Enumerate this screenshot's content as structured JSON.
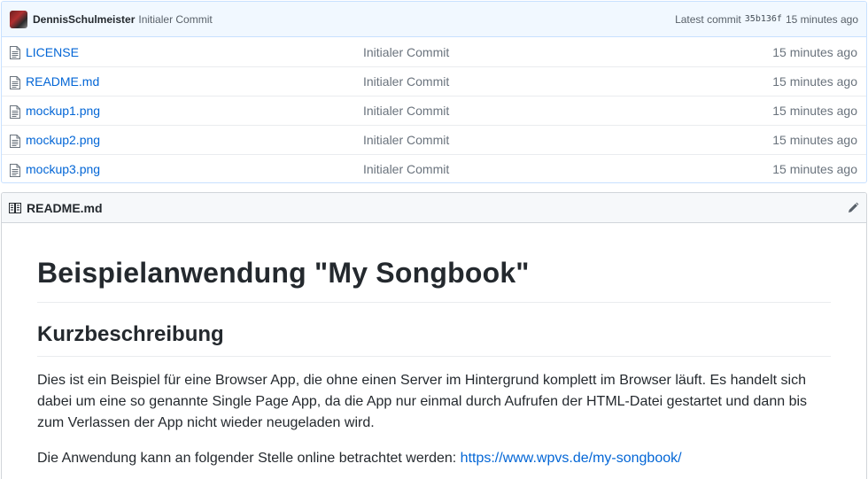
{
  "commit": {
    "author": "DennisSchulmeister",
    "message": "Initialer Commit",
    "latest_label": "Latest commit",
    "sha": "35b136f",
    "age": "15 minutes ago"
  },
  "files": [
    {
      "name": "LICENSE",
      "message": "Initialer Commit",
      "age": "15 minutes ago"
    },
    {
      "name": "README.md",
      "message": "Initialer Commit",
      "age": "15 minutes ago"
    },
    {
      "name": "mockup1.png",
      "message": "Initialer Commit",
      "age": "15 minutes ago"
    },
    {
      "name": "mockup2.png",
      "message": "Initialer Commit",
      "age": "15 minutes ago"
    },
    {
      "name": "mockup3.png",
      "message": "Initialer Commit",
      "age": "15 minutes ago"
    }
  ],
  "readme": {
    "filename": "README.md",
    "title": "Beispielanwendung \"My Songbook\"",
    "section_heading": "Kurzbeschreibung",
    "paragraph1": "Dies ist ein Beispiel für eine Browser App, die ohne einen Server im Hintergrund komplett im Browser läuft. Es handelt sich dabei um eine so genannte Single Page App, da die App nur einmal durch Aufrufen der HTML-Datei gestartet und dann bis zum Verlassen der App nicht wieder neugeladen wird.",
    "paragraph2_prefix": "Die Anwendung kann an folgender Stelle online betrachtet werden: ",
    "paragraph2_link": "https://www.wpvs.de/my-songbook/"
  },
  "icons": {
    "file": "file-icon",
    "book": "book-icon",
    "pencil": "pencil-icon"
  }
}
